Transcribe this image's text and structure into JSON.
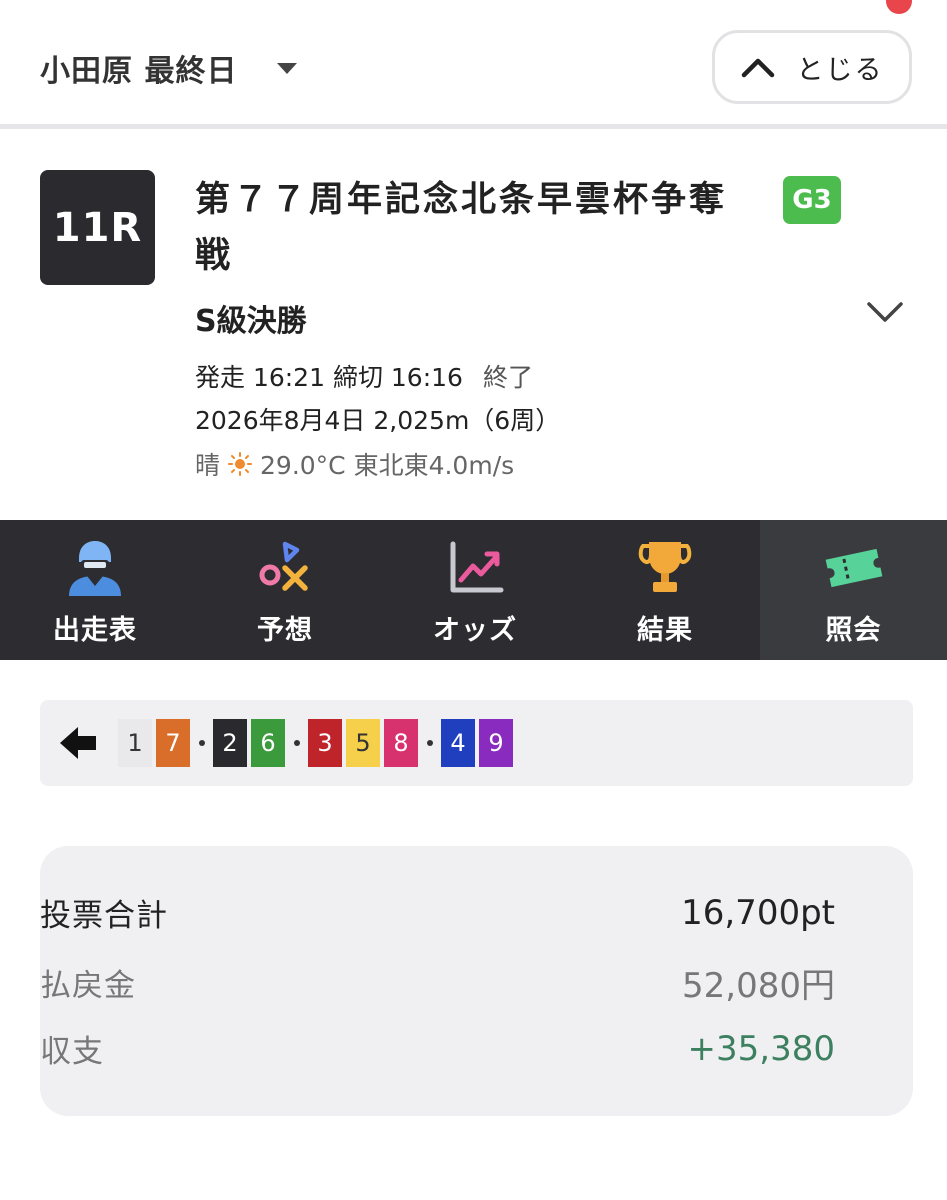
{
  "header": {
    "venue_label": "小田原 最終日",
    "close_label": "とじる"
  },
  "race": {
    "number": "11R",
    "title": "第７７周年記念北条早雲杯争奪戦",
    "grade": "G3",
    "grade_color": "#4cbc4f",
    "class": "S級決勝",
    "start_time_text": "発走 16:21 締切 16:16",
    "status": "終了",
    "date_distance": "2026年8月4日 2,025m（6周）",
    "weather_label": "晴",
    "weather_icon": "sun-icon",
    "weather_detail": "29.0°C 東北東4.0m/s"
  },
  "tabs": [
    {
      "label": "出走表",
      "icon": "rider-icon",
      "active": false
    },
    {
      "label": "予想",
      "icon": "prediction-symbols-icon",
      "active": false
    },
    {
      "label": "オッズ",
      "icon": "odds-chart-icon",
      "active": false
    },
    {
      "label": "結果",
      "icon": "trophy-icon",
      "active": false
    },
    {
      "label": "照会",
      "icon": "ticket-icon",
      "active": true
    }
  ],
  "lineup": {
    "groups": [
      [
        {
          "num": "1",
          "bg": "#e9e9ec",
          "fg": "#333333"
        },
        {
          "num": "7",
          "bg": "#d96d2a",
          "fg": "#ffffff"
        }
      ],
      [
        {
          "num": "2",
          "bg": "#2a2a2e",
          "fg": "#ffffff"
        },
        {
          "num": "6",
          "bg": "#3a9a3c",
          "fg": "#ffffff"
        }
      ],
      [
        {
          "num": "3",
          "bg": "#c0242b",
          "fg": "#ffffff"
        },
        {
          "num": "5",
          "bg": "#f6d04a",
          "fg": "#333333"
        },
        {
          "num": "8",
          "bg": "#d8326e",
          "fg": "#ffffff"
        }
      ],
      [
        {
          "num": "4",
          "bg": "#1f3fbf",
          "fg": "#ffffff"
        },
        {
          "num": "9",
          "bg": "#8a2bc0",
          "fg": "#ffffff"
        }
      ]
    ]
  },
  "summary": {
    "bet_total_label": "投票合計",
    "bet_total_value": "16,700pt",
    "payout_label": "払戻金",
    "payout_value": "52,080円",
    "balance_label": "収支",
    "balance_value": "+35,380",
    "balance_color": "#3c8060"
  }
}
